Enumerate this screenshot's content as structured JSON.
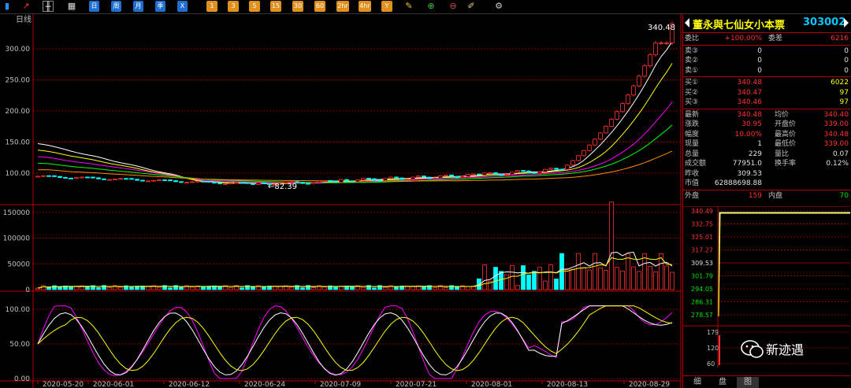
{
  "toolbar": {
    "period_buttons": [
      "日",
      "周",
      "月",
      "季",
      "X"
    ],
    "minute_buttons": [
      "1",
      "3",
      "5",
      "15",
      "30",
      "60",
      "2hr",
      "4hr",
      "Y"
    ]
  },
  "chart": {
    "period_label": "日线",
    "low_annotation": "←82.39",
    "high_annotation": "340.48",
    "price_axis": [
      "300.00",
      "250.00",
      "200.00",
      "150.00",
      "100.00"
    ],
    "volume_axis": [
      "150000",
      "100000",
      "50000",
      "0"
    ],
    "indicator_axis": [
      "100.00",
      "50.00",
      "0.00"
    ],
    "dates": [
      "2020-05-20",
      "2020-06-01",
      "2020-06-12",
      "2020-06-24",
      "2020-07-09",
      "2020-07-21",
      "2020-08-01",
      "2020-08-13",
      "2020-08-29"
    ]
  },
  "stock": {
    "name": "董永與七仙女小本票",
    "code": "303002"
  },
  "quote": {
    "wei_bi_label": "委比",
    "wei_bi": "+100.00%",
    "wei_cha_label": "委差",
    "wei_cha": "6216",
    "sells": [
      {
        "label": "卖③",
        "price": "0",
        "vol": "0"
      },
      {
        "label": "卖②",
        "price": "0",
        "vol": "0"
      },
      {
        "label": "卖①",
        "price": "0",
        "vol": "0"
      }
    ],
    "buys": [
      {
        "label": "买①",
        "price": "340.48",
        "vol": "6022"
      },
      {
        "label": "买②",
        "price": "340.47",
        "vol": "97"
      },
      {
        "label": "买③",
        "price": "340.46",
        "vol": "97"
      }
    ],
    "stats": [
      {
        "l": "最新",
        "v": "340.48",
        "rl": "均价",
        "rv": "340.40",
        "vc": "red",
        "rvc": "red"
      },
      {
        "l": "涨跌",
        "v": "30.95",
        "rl": "开盘价",
        "rv": "339.00",
        "vc": "red",
        "rvc": "red"
      },
      {
        "l": "幅度",
        "v": "10.00%",
        "rl": "最高价",
        "rv": "340.48",
        "vc": "red",
        "rvc": "red"
      },
      {
        "l": "现量",
        "v": "1",
        "rl": "最低价",
        "rv": "339.00",
        "vc": "white",
        "rvc": "red"
      },
      {
        "l": "总量",
        "v": "229",
        "rl": "量比",
        "rv": "0.07",
        "vc": "white",
        "rvc": "white"
      },
      {
        "l": "成交额",
        "v": "77951.0",
        "rl": "换手率",
        "rv": "0.12%",
        "vc": "white",
        "rvc": "white"
      },
      {
        "l": "昨收",
        "v": "309.53",
        "rl": "",
        "rv": "",
        "vc": "white",
        "rvc": "white"
      },
      {
        "l": "市值",
        "v": "62888698.88",
        "rl": "",
        "rv": "",
        "vc": "white",
        "rvc": "white"
      }
    ],
    "outer_label": "外盘",
    "outer": "159",
    "inner_label": "内盘",
    "inner": "70"
  },
  "mini_axis": [
    "340.49",
    "332.75",
    "325.01",
    "317.27",
    "309.53",
    "301.79",
    "294.05",
    "286.31",
    "278.57"
  ],
  "mini_vol_axis": [
    "179",
    "120",
    "60"
  ],
  "tabs": [
    "细",
    "盘",
    "图"
  ],
  "watermark": "新迹遇",
  "colors": {
    "up": "#ff3232",
    "down": "#00ffff",
    "grid": "#8b0000",
    "ma5": "#ffffff",
    "ma10": "#ffff00",
    "ma20": "#ff00ff",
    "ma30": "#00ff00",
    "ma60": "#ff8c00"
  }
}
